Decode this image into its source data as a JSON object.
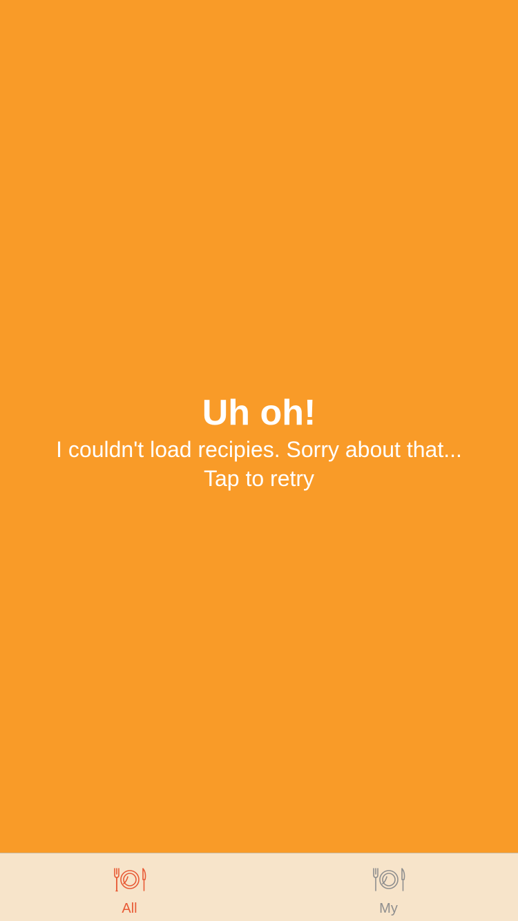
{
  "error": {
    "title": "Uh oh!",
    "message": "I couldn't load recipies. Sorry about that...",
    "retry_label": "Tap to retry"
  },
  "tabbar": {
    "tabs": [
      {
        "label": "All",
        "icon": "plate-cutlery-icon",
        "active": true,
        "color": "#E85A35"
      },
      {
        "label": "My",
        "icon": "plate-cutlery-icon",
        "active": false,
        "color": "#8E8E8E"
      }
    ]
  },
  "colors": {
    "background": "#F99B28",
    "tabbar_background": "#F7E4CA",
    "text": "#FFFFFF",
    "accent": "#E85A35",
    "inactive": "#8E8E8E"
  }
}
